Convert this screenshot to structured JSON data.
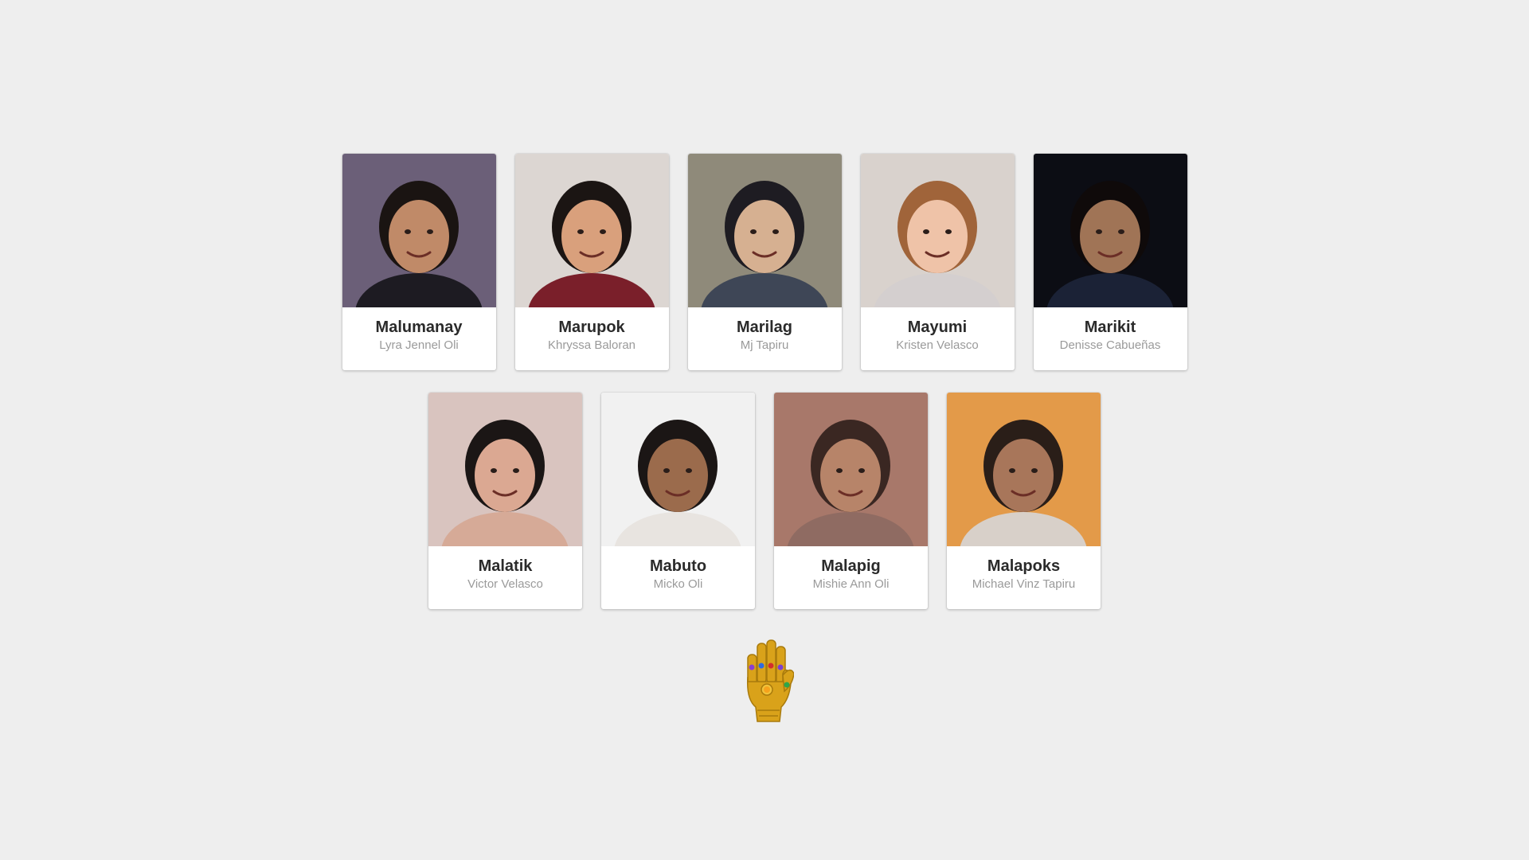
{
  "cards": [
    {
      "nickname": "Malumanay",
      "name": "Lyra Jennel Oli",
      "bg": "#6b5f78",
      "skin": "#c08a68",
      "hair": "#1a1412",
      "top": "#1d1b22",
      "icon": "portrait-photo"
    },
    {
      "nickname": "Marupok",
      "name": "Khryssa Baloran",
      "bg": "#dcd6d2",
      "skin": "#d9a07c",
      "hair": "#1b1513",
      "top": "#7a1f2a",
      "icon": "portrait-photo"
    },
    {
      "nickname": "Marilag",
      "name": "Mj Tapiru",
      "bg": "#8f8a7a",
      "skin": "#d6b091",
      "hair": "#1e1c22",
      "top": "#3e4656",
      "icon": "portrait-photo"
    },
    {
      "nickname": "Mayumi",
      "name": "Kristen Velasco",
      "bg": "#d9d2cd",
      "skin": "#efc3a8",
      "hair": "#a0643a",
      "top": "#d4cfcf",
      "icon": "portrait-photo"
    },
    {
      "nickname": "Marikit",
      "name": "Denisse Cabueñas",
      "bg": "#0c0d14",
      "skin": "#a07456",
      "hair": "#0f0a0a",
      "top": "#1b2236",
      "icon": "portrait-photo"
    },
    {
      "nickname": "Malatik",
      "name": "Victor Velasco",
      "bg": "#d9c4bf",
      "skin": "#dba892",
      "hair": "#1b1615",
      "top": "#d6aa97",
      "icon": "portrait-photo"
    },
    {
      "nickname": "Mabuto",
      "name": "Micko Oli",
      "bg": "#f1f1f1",
      "skin": "#9b6b4c",
      "hair": "#1b1615",
      "top": "#e8e4e0",
      "icon": "portrait-photo"
    },
    {
      "nickname": "Malapig",
      "name": "Mishie Ann Oli",
      "bg": "#a8786a",
      "skin": "#b78469",
      "hair": "#3a2722",
      "top": "#8f6b62",
      "icon": "portrait-photo"
    },
    {
      "nickname": "Malapoks",
      "name": "Michael Vinz Tapiru",
      "bg": "#e39a49",
      "skin": "#a8765a",
      "hair": "#2a1e18",
      "top": "#d8d0c9",
      "icon": "portrait-photo"
    }
  ],
  "gauntlet": {
    "icon": "infinity-gauntlet-icon",
    "gold": "#d9a21a"
  }
}
